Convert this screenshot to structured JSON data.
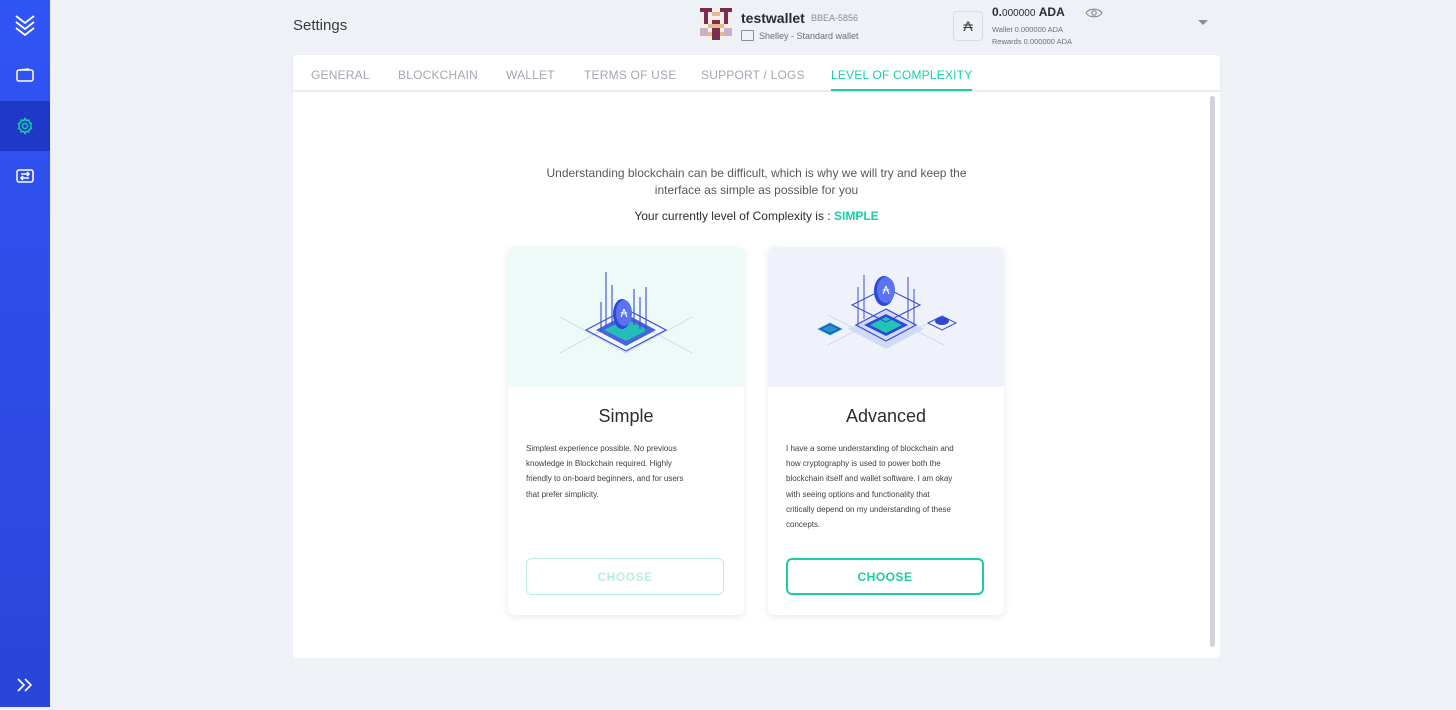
{
  "header": {
    "title": "Settings",
    "wallet": {
      "name": "testwallet",
      "plate": "BBEA-5856",
      "type": "Shelley - Standard wallet"
    },
    "balance": {
      "integer": "0.",
      "decimals": "000000",
      "currency": "ADA",
      "wallet_line": "Wallet 0.000000 ADA",
      "rewards_line": "Rewards 0.000000 ADA"
    },
    "ada_symbol": "₳"
  },
  "sidebar": {
    "items": [
      {
        "icon": "logo-icon"
      },
      {
        "icon": "wallet-icon"
      },
      {
        "icon": "settings-gear-icon",
        "active": true
      },
      {
        "icon": "transfer-icon"
      },
      {
        "icon": "expand-chevrons-icon"
      }
    ]
  },
  "tabs": [
    {
      "label": "GENERAL"
    },
    {
      "label": "BLOCKCHAIN"
    },
    {
      "label": "WALLET"
    },
    {
      "label": "TERMS OF USE"
    },
    {
      "label": "SUPPORT / LOGS"
    },
    {
      "label": "LEVEL OF COMPLEXITY",
      "active": true
    }
  ],
  "main": {
    "intro_line1": "Understanding blockchain can be difficult, which is why we will try and keep the",
    "intro_line2": "interface as simple as possible for you",
    "current_prefix": "Your currently level of Complexity is : ",
    "current_level": "SIMPLE",
    "cards": [
      {
        "title": "Simple",
        "desc_lines": [
          "Simplest experience possible. No previous",
          "knowledge in Blockchain required. Highly",
          "friendly to on-board beginners, and for users",
          "that prefer simplicity."
        ],
        "button": "CHOOSE",
        "button_state": "disabled"
      },
      {
        "title": "Advanced",
        "desc_lines": [
          "I have a some understanding of blockchain and",
          "how cryptography is used to power both the",
          "blockchain itself and wallet software. I am okay",
          "with seeing options and functionality that",
          "critically depend on my understanding of these",
          "concepts."
        ],
        "button": "CHOOSE",
        "button_state": "enabled"
      }
    ]
  },
  "colors": {
    "accent": "#17cfa3",
    "sidebar": "#3154f5",
    "sidebar_active": "#1e38c7",
    "background": "#eef1f5"
  }
}
